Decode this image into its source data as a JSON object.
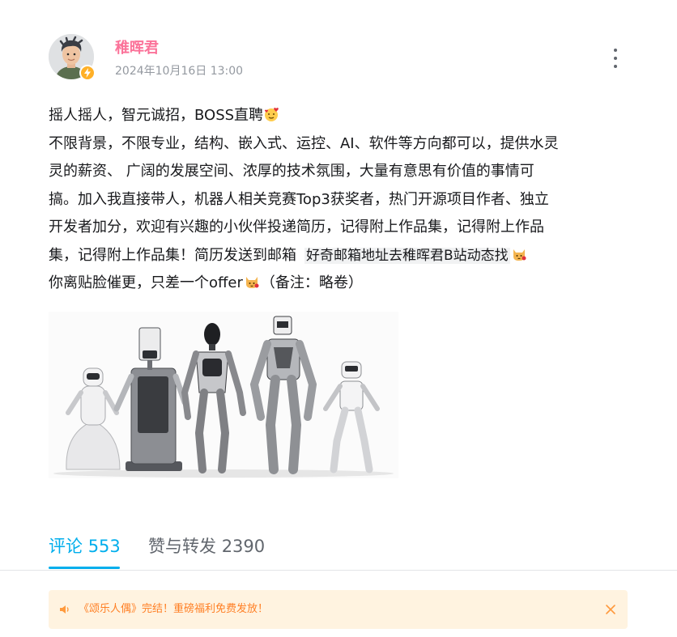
{
  "author": {
    "name": "稚晖君",
    "publish_time": "2024年10月16日 13:00",
    "badge_icon": "lightning-icon",
    "accent_color": "#fb7299"
  },
  "content": {
    "line1": "摇人摇人，智元诚招，BOSS直聘",
    "line2": "不限背景，不限专业，结构、嵌入式、运控、AI、软件等方向都可以，提供水灵",
    "line3": "灵的薪资、 广阔的发展空间、浓厚的技术氛围，大量有意思有价值的事情可",
    "line4": "搞。加入我直接带人，机器人相关竞赛Top3获奖者，热门开源项目作者、独立",
    "line5": "开发者加分，欢迎有兴趣的小伙伴投递简历，记得附上作品集，记得附上作品",
    "line6_prefix": "集，记得附上作品集！简历发送到邮箱",
    "line6_highlight": "好奇邮箱地址去稚晖君B站动态找",
    "line7_prefix": "你离贴脸催更，只差一个offer",
    "line7_suffix": "（备注：略卷）",
    "emojis": [
      "heart-face-emoji",
      "cat-face-emoji",
      "cat-face-emoji"
    ]
  },
  "tabs": {
    "comment_label": "评论",
    "comment_count": "553",
    "forward_label": "赞与转发",
    "forward_count": "2390",
    "active_color": "#00aeec"
  },
  "notice": {
    "text": "《颂乐人偶》完结！重磅福利免费发放！",
    "icon": "speaker-icon",
    "close_icon": "close-icon",
    "bg_color": "#fff3e0",
    "text_color": "#ff7f24"
  }
}
